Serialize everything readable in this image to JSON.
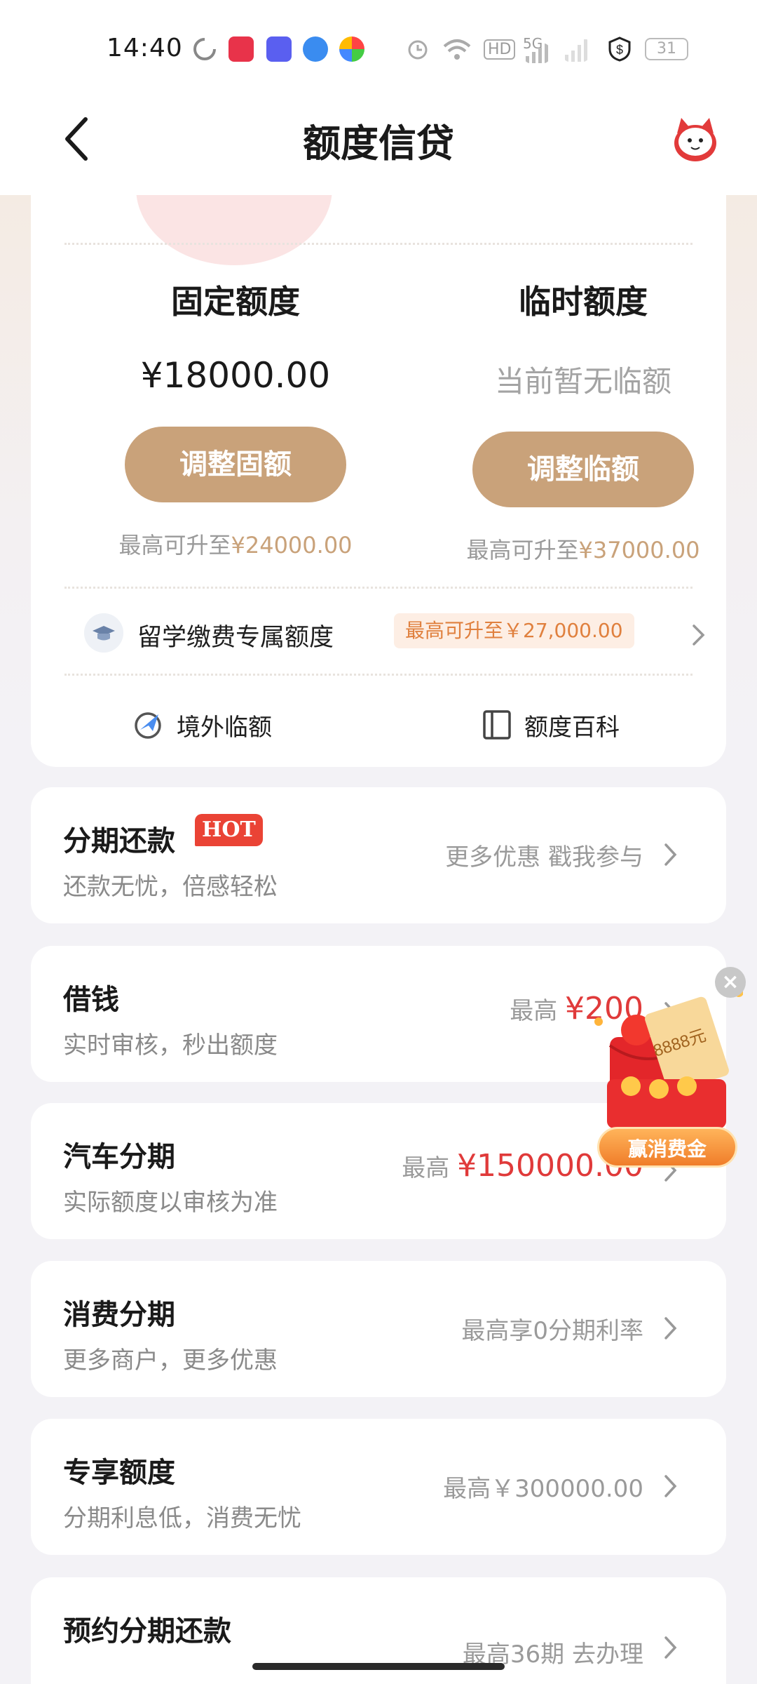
{
  "status_bar": {
    "time": "14:40",
    "battery": "31",
    "network": "5G",
    "hd": "HD"
  },
  "header": {
    "title": "额度信贷"
  },
  "quota": {
    "fixed": {
      "title": "固定额度",
      "amount": "¥18000.00",
      "button": "调整固额",
      "max_prefix": "最高可升至",
      "max_amount": "¥24000.00"
    },
    "temp": {
      "title": "临时额度",
      "status": "当前暂无临额",
      "button": "调整临额",
      "max_prefix": "最高可升至",
      "max_amount": "¥37000.00"
    },
    "study_abroad": {
      "label": "留学缴费专属额度",
      "tag": "最高可升至￥27,000.00"
    },
    "links": {
      "overseas": "境外临额",
      "wiki": "额度百科"
    }
  },
  "services": [
    {
      "title": "分期还款",
      "badge": "HOT",
      "subtitle": "还款无忧，倍感轻松",
      "right_text": "更多优惠 戳我参与",
      "right_value": ""
    },
    {
      "title": "借钱",
      "subtitle": "实时审核，秒出额度",
      "right_text": "最高 ",
      "right_value": "¥200"
    },
    {
      "title": "汽车分期",
      "subtitle": "实际额度以审核为准",
      "right_text": "最高 ",
      "right_value": "¥150000.00"
    },
    {
      "title": "消费分期",
      "subtitle": "更多商户，更多优惠",
      "right_text": "最高享0分期利率",
      "right_value": ""
    },
    {
      "title": "专享额度",
      "subtitle": "分期利息低，消费无忧",
      "right_text": "最高￥300000.00",
      "right_value": ""
    },
    {
      "title": "预约分期还款",
      "subtitle": "",
      "right_text": "最高36期  去办理",
      "right_value": ""
    }
  ],
  "promo": {
    "label": "赢消费金",
    "coupon_text": "8888元"
  },
  "colors": {
    "gold": "#c9a27a",
    "red": "#e03a3a",
    "orange_tag": "#e0803e"
  }
}
